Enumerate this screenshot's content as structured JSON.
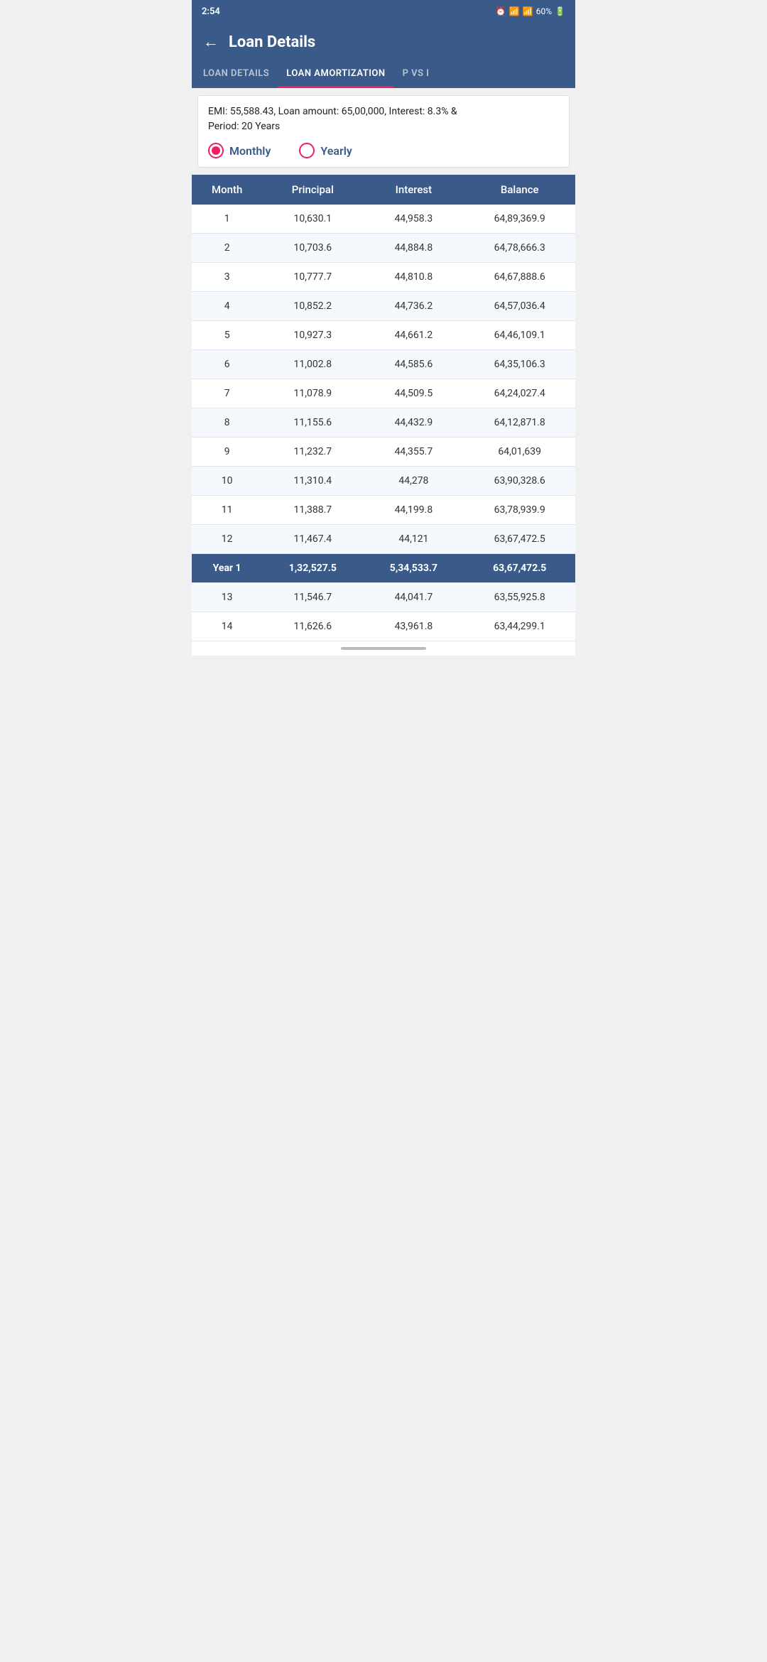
{
  "statusBar": {
    "time": "2:54",
    "battery": "60%"
  },
  "appBar": {
    "title": "Loan Details",
    "backLabel": "←"
  },
  "tabs": [
    {
      "id": "loan-details",
      "label": "LOAN DETAILS",
      "active": false
    },
    {
      "id": "loan-amortization",
      "label": "LOAN AMORTIZATION",
      "active": true
    },
    {
      "id": "p-vs-i",
      "label": "P VS I",
      "active": false
    }
  ],
  "infoBox": {
    "text": "EMI: 55,588.43, Loan amount: 65,00,000, Interest: 8.3%  &\nPeriod: 20 Years"
  },
  "radioGroup": {
    "monthly": {
      "label": "Monthly",
      "selected": true
    },
    "yearly": {
      "label": "Yearly",
      "selected": false
    }
  },
  "table": {
    "headers": [
      "Month",
      "Principal",
      "Interest",
      "Balance"
    ],
    "rows": [
      {
        "col1": "1",
        "col2": "10,630.1",
        "col3": "44,958.3",
        "col4": "64,89,369.9",
        "isYear": false
      },
      {
        "col1": "2",
        "col2": "10,703.6",
        "col3": "44,884.8",
        "col4": "64,78,666.3",
        "isYear": false
      },
      {
        "col1": "3",
        "col2": "10,777.7",
        "col3": "44,810.8",
        "col4": "64,67,888.6",
        "isYear": false
      },
      {
        "col1": "4",
        "col2": "10,852.2",
        "col3": "44,736.2",
        "col4": "64,57,036.4",
        "isYear": false
      },
      {
        "col1": "5",
        "col2": "10,927.3",
        "col3": "44,661.2",
        "col4": "64,46,109.1",
        "isYear": false
      },
      {
        "col1": "6",
        "col2": "11,002.8",
        "col3": "44,585.6",
        "col4": "64,35,106.3",
        "isYear": false
      },
      {
        "col1": "7",
        "col2": "11,078.9",
        "col3": "44,509.5",
        "col4": "64,24,027.4",
        "isYear": false
      },
      {
        "col1": "8",
        "col2": "11,155.6",
        "col3": "44,432.9",
        "col4": "64,12,871.8",
        "isYear": false
      },
      {
        "col1": "9",
        "col2": "11,232.7",
        "col3": "44,355.7",
        "col4": "64,01,639",
        "isYear": false
      },
      {
        "col1": "10",
        "col2": "11,310.4",
        "col3": "44,278",
        "col4": "63,90,328.6",
        "isYear": false
      },
      {
        "col1": "11",
        "col2": "11,388.7",
        "col3": "44,199.8",
        "col4": "63,78,939.9",
        "isYear": false
      },
      {
        "col1": "12",
        "col2": "11,467.4",
        "col3": "44,121",
        "col4": "63,67,472.5",
        "isYear": false
      },
      {
        "col1": "Year 1",
        "col2": "1,32,527.5",
        "col3": "5,34,533.7",
        "col4": "63,67,472.5",
        "isYear": true
      },
      {
        "col1": "13",
        "col2": "11,546.7",
        "col3": "44,041.7",
        "col4": "63,55,925.8",
        "isYear": false
      },
      {
        "col1": "14",
        "col2": "11,626.6",
        "col3": "43,961.8",
        "col4": "63,44,299.1",
        "isYear": false
      }
    ]
  }
}
